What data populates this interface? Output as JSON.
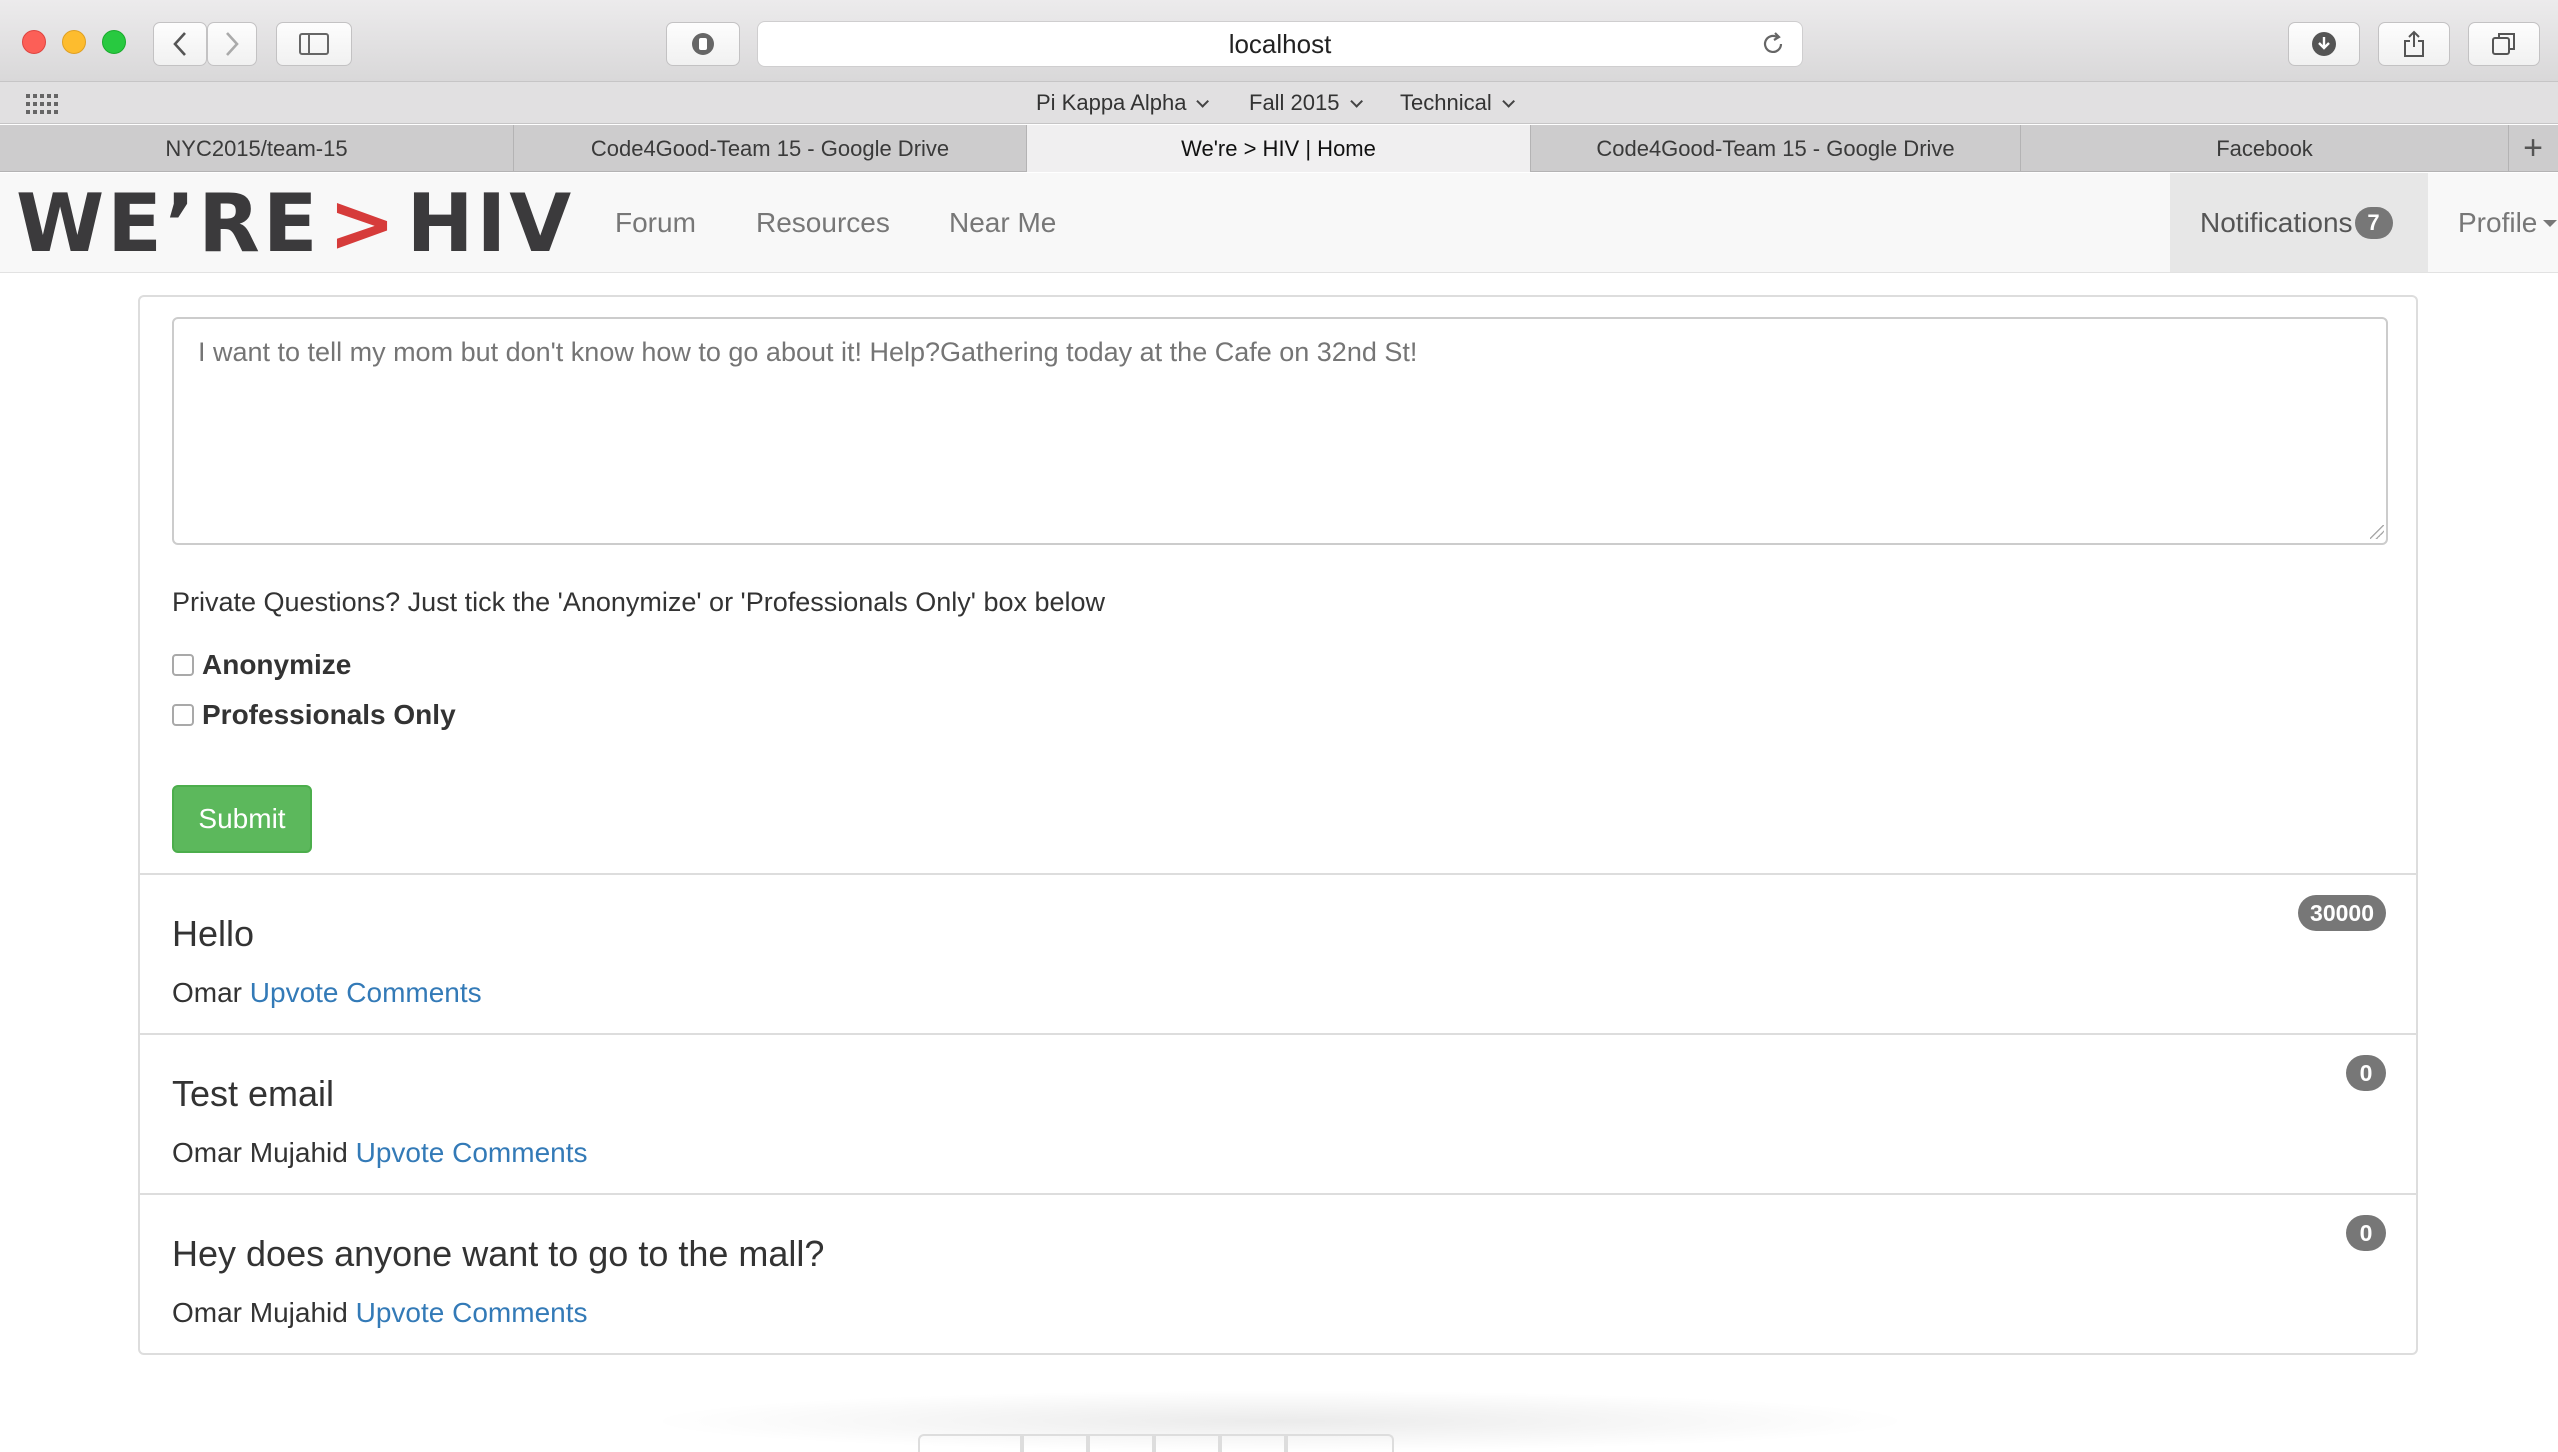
{
  "browser": {
    "address": "localhost",
    "bookmarks": [
      "Pi Kappa Alpha",
      "Fall 2015",
      "Technical"
    ],
    "tabs": [
      {
        "label": "NYC2015/team-15",
        "active": false
      },
      {
        "label": "Code4Good-Team 15 - Google Drive",
        "active": false
      },
      {
        "label": "We're > HIV | Home",
        "active": true
      },
      {
        "label": "Code4Good-Team 15 - Google Drive",
        "active": false
      },
      {
        "label": "Facebook",
        "active": false
      }
    ]
  },
  "site": {
    "logo": {
      "left": "WE’RE",
      "sep": ">",
      "right": "HIV"
    },
    "nav": [
      "Forum",
      "Resources",
      "Near Me"
    ],
    "notifications": {
      "label": "Notifications",
      "count": "7"
    },
    "profile": "Profile"
  },
  "compose": {
    "placeholder": "I want to tell my mom but don't know how to go about it! Help?Gathering today at the Cafe on 32nd St!",
    "help": "Private Questions? Just tick the 'Anonymize' or 'Professionals Only' box below",
    "anonymize": "Anonymize",
    "professionals": "Professionals Only",
    "submit": "Submit"
  },
  "posts": [
    {
      "title": "Hello",
      "author": "Omar",
      "upvote": "Upvote",
      "comments": "Comments",
      "votes": "30000"
    },
    {
      "title": "Test email",
      "author": "Omar Mujahid",
      "upvote": "Upvote",
      "comments": "Comments",
      "votes": "0"
    },
    {
      "title": "Hey does anyone want to go to the mall?",
      "author": "Omar Mujahid",
      "upvote": "Upvote",
      "comments": "Comments",
      "votes": "0"
    }
  ]
}
